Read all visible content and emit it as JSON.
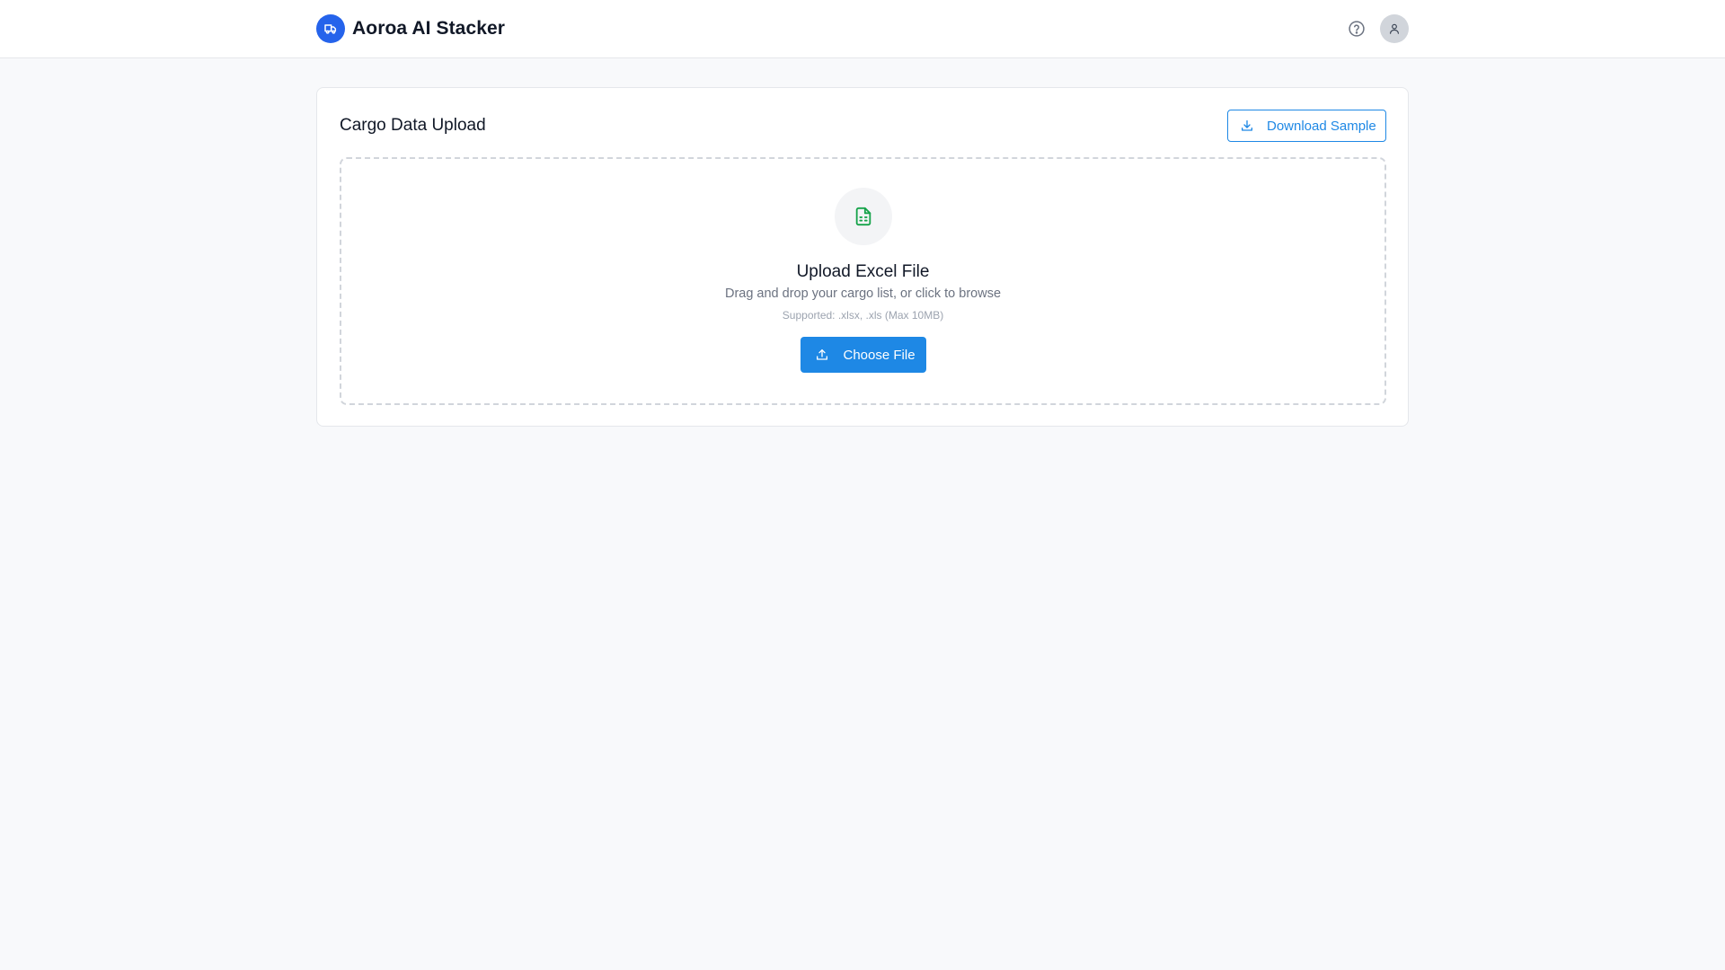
{
  "app": {
    "title": "Aoroa AI Stacker",
    "logo_icon": "truck-icon",
    "accent_color": "#2563eb",
    "primary_color": "#1e88e5"
  },
  "header": {
    "help_icon": "help-circle-icon",
    "avatar_icon": "user-icon"
  },
  "upload_card": {
    "title": "Cargo Data Upload",
    "download_button": {
      "label": "Download Sample",
      "icon": "download-icon"
    },
    "dropzone": {
      "icon": "spreadsheet-file-icon",
      "icon_color": "#16a34a",
      "title": "Upload Excel File",
      "subtitle": "Drag and drop your cargo list, or click to browse",
      "supported": "Supported: .xlsx, .xls (Max 10MB)",
      "choose_button": {
        "label": "Choose File",
        "icon": "upload-icon"
      }
    }
  }
}
